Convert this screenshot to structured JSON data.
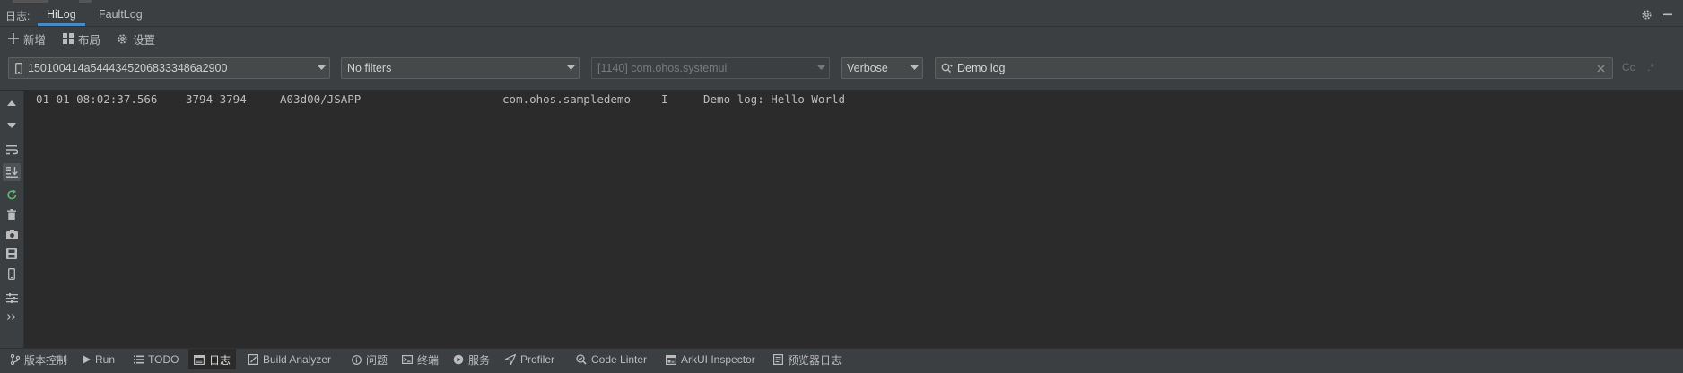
{
  "tabs_bar": {
    "label": "日志:",
    "tabs": [
      {
        "label": "HiLog",
        "active": true
      },
      {
        "label": "FaultLog",
        "active": false
      }
    ],
    "right_icons": [
      "gear-icon",
      "minimize-icon"
    ]
  },
  "toolbar": {
    "new_label": "新增",
    "layout_label": "布局",
    "settings_label": "设置"
  },
  "filters": {
    "device": "150100414a54443452068333486a2900",
    "filter": "No filters",
    "process": "[1140] com.ohos.systemui",
    "level": "Verbose",
    "search_value": "Demo log",
    "case_label": "Cc",
    "regex_label": ".*"
  },
  "log_lines": [
    {
      "time": "01-01 08:02:37.566",
      "pid": "3794-3794",
      "tag": "A03d00/JSAPP",
      "package": "com.ohos.sampledemo",
      "level": "I",
      "message": "Demo log: Hello World"
    }
  ],
  "bottom_bar": {
    "items": [
      {
        "label": "版本控制",
        "icon": "branch-icon"
      },
      {
        "label": "Run",
        "icon": "run-icon"
      },
      {
        "label": "TODO",
        "icon": "list-icon"
      },
      {
        "label": "日志",
        "icon": "log-icon",
        "active": true
      },
      {
        "label": "Build Analyzer",
        "icon": "build-analyzer-icon"
      },
      {
        "label": "问题",
        "icon": "info-icon"
      },
      {
        "label": "终端",
        "icon": "terminal-icon"
      },
      {
        "label": "服务",
        "icon": "services-icon"
      },
      {
        "label": "Profiler",
        "icon": "profiler-icon"
      },
      {
        "label": "Code Linter",
        "icon": "code-linter-icon"
      },
      {
        "label": "ArkUI Inspector",
        "icon": "inspector-icon"
      },
      {
        "label": "预览器日志",
        "icon": "preview-log-icon"
      }
    ]
  },
  "colors": {
    "background": "#2b2b2b",
    "panel": "#3c3f41",
    "accent": "#4a88c7",
    "text": "#bbbbbb"
  }
}
